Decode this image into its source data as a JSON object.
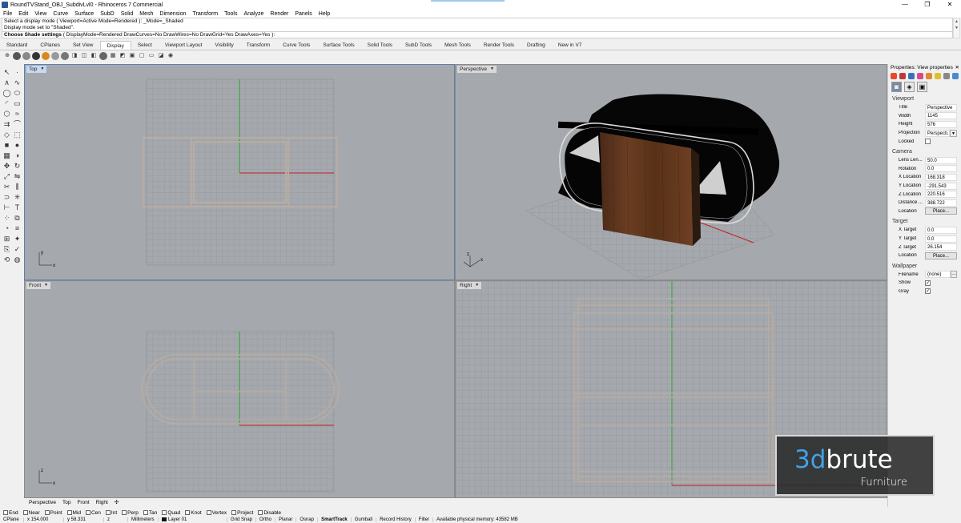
{
  "window": {
    "title": "RoundTVStand_OBJ_SubdivLvl0 - Rhinoceros 7 Commercial",
    "controls": [
      "—",
      "❐",
      "✕"
    ]
  },
  "menu": [
    "File",
    "Edit",
    "View",
    "Curve",
    "Surface",
    "SubD",
    "Solid",
    "Mesh",
    "Dimension",
    "Transform",
    "Tools",
    "Analyze",
    "Render",
    "Panels",
    "Help"
  ],
  "command": {
    "history": [
      "Select a display mode ( Viewport=Active  Mode=Rendered ): _Mode=_Shaded",
      "Display mode set to \"Shaded\"."
    ],
    "prompt": "Choose Shade settings",
    "options": "( DisplayMode=Rendered  DrawCurves=No  DrawWires=No  DrawGrid=Yes  DrawAxes=Yes ):"
  },
  "tabs": [
    "Standard",
    "CPlanes",
    "Set View",
    "Display",
    "Select",
    "Viewport Layout",
    "Visibility",
    "Transform",
    "Curve Tools",
    "Surface Tools",
    "Solid Tools",
    "SubD Tools",
    "Mesh Tools",
    "Render Tools",
    "Drafting",
    "New in V7"
  ],
  "active_tab": "Display",
  "viewports": {
    "top": {
      "title": "Top"
    },
    "perspective": {
      "title": "Perspective"
    },
    "front": {
      "title": "Front"
    },
    "right": {
      "title": "Right"
    }
  },
  "viewport_tabs": [
    "Perspective",
    "Top",
    "Front",
    "Right",
    "✣"
  ],
  "osnaps": [
    "End",
    "Near",
    "Point",
    "Mid",
    "Cen",
    "Int",
    "Perp",
    "Tan",
    "Quad",
    "Knot",
    "Vertex",
    "Project",
    "Disable"
  ],
  "status": {
    "cplane": "CPlane",
    "x": "x 154.000",
    "y": "y 58.331",
    "z": "z",
    "units": "Millimeters",
    "layer": "Layer 01",
    "toggles": [
      "Grid Snap",
      "Ortho",
      "Planar",
      "Osnap",
      "SmartTrack",
      "Gumball",
      "Record History",
      "Filter"
    ],
    "memory": "Available physical memory: 43582 MB"
  },
  "properties": {
    "header": "Properties: View properties",
    "viewport": {
      "section": "Viewport",
      "title_label": "Title",
      "title": "Perspective",
      "width_label": "Width",
      "width": "1145",
      "height_label": "Height",
      "height": "576",
      "projection_label": "Projection",
      "projection": "Perspecti...",
      "locked_label": "Locked"
    },
    "camera": {
      "section": "Camera",
      "lens_label": "Lens Len...",
      "lens": "50.0",
      "rotation_label": "Rotation",
      "rotation": "0.0",
      "xloc_label": "X Location",
      "xloc": "168.318",
      "yloc_label": "Y Location",
      "yloc": "-291.543",
      "zloc_label": "Z Location",
      "zloc": "220.516",
      "distance_label": "Distance ...",
      "distance": "388.722",
      "location_label": "Location",
      "place": "Place..."
    },
    "target": {
      "section": "Target",
      "x_label": "X Target",
      "x": "0.0",
      "y_label": "Y Target",
      "y": "0.0",
      "z_label": "Z Target",
      "z": "26.154",
      "location_label": "Location",
      "place": "Place..."
    },
    "wallpaper": {
      "section": "Wallpaper",
      "filename_label": "Filename",
      "filename": "(none)",
      "show_label": "Show",
      "gray_label": "Gray"
    }
  },
  "watermark": {
    "brand_a": "3d",
    "brand_b": "brute",
    "sub": "Furniture"
  }
}
